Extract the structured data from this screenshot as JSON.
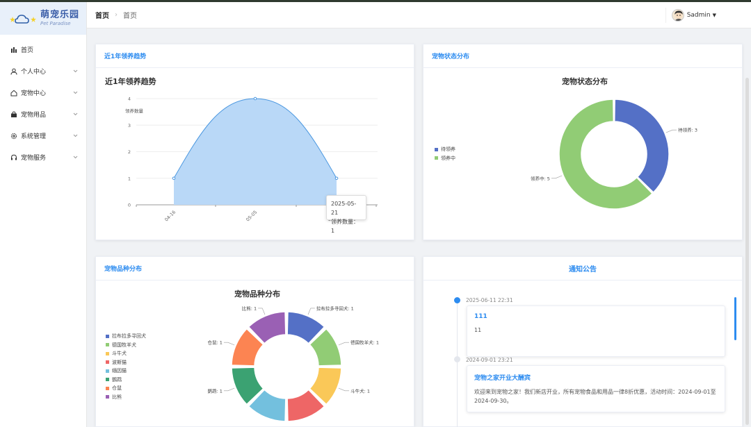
{
  "app": {
    "title": "萌宠乐园",
    "subtitle": "Pet Paradise"
  },
  "sidebar": {
    "items": [
      {
        "label": "首页",
        "icon": "bar-chart-icon",
        "has_children": false
      },
      {
        "label": "个人中心",
        "icon": "user-icon",
        "has_children": true
      },
      {
        "label": "宠物中心",
        "icon": "home-icon",
        "has_children": true
      },
      {
        "label": "宠物用品",
        "icon": "bag-icon",
        "has_children": true
      },
      {
        "label": "系统管理",
        "icon": "gear-icon",
        "has_children": true
      },
      {
        "label": "宠物服务",
        "icon": "headset-icon",
        "has_children": true
      }
    ]
  },
  "header": {
    "breadcrumb_home": "首页",
    "breadcrumb_sep": "›",
    "breadcrumb_current": "首页",
    "user_name": "Sadmin"
  },
  "cards": {
    "trend": {
      "header": "近1年领养趋势"
    },
    "status": {
      "header": "宠物状态分布"
    },
    "breed": {
      "header": "宠物品种分布"
    },
    "notice": {
      "header": "通知公告"
    }
  },
  "chart_data": [
    {
      "type": "area",
      "title": "近1年领养趋势",
      "ylabel": "领养数量",
      "x": [
        "04-16",
        "05-05",
        "05-21"
      ],
      "values": [
        1,
        4,
        1
      ],
      "ylim": [
        0,
        4
      ],
      "yticks": [
        0,
        1,
        2,
        3,
        4
      ],
      "grid": true,
      "tooltip": {
        "date": "2025-05-21",
        "label": "领养数量",
        "value": "1"
      },
      "color": "#b9d8f7",
      "line_color": "#4a97e0"
    },
    {
      "type": "pie",
      "title": "宠物状态分布",
      "donut": true,
      "series": [
        {
          "name": "待领养",
          "value": 3,
          "color": "#5470c6",
          "label": "待领养: 3"
        },
        {
          "name": "领养中",
          "value": 5,
          "color": "#91cc75",
          "label": "领养中: 5"
        }
      ],
      "legend": "left"
    },
    {
      "type": "pie",
      "title": "宠物品种分布",
      "donut": true,
      "series": [
        {
          "name": "拉布拉多寻回犬",
          "value": 1,
          "color": "#5470c6",
          "label": "拉布拉多寻回犬: 1"
        },
        {
          "name": "德国牧羊犬",
          "value": 1,
          "color": "#91cc75",
          "label": "德国牧羊犬: 1"
        },
        {
          "name": "斗牛犬",
          "value": 1,
          "color": "#fac858",
          "label": "斗牛犬: 1"
        },
        {
          "name": "波斯猫",
          "value": 1,
          "color": "#ee6666",
          "label": ""
        },
        {
          "name": "缅因猫",
          "value": 1,
          "color": "#73c0de",
          "label": ""
        },
        {
          "name": "鹦鹉",
          "value": 1,
          "color": "#3ba272",
          "label": "鹦鹉: 1"
        },
        {
          "name": "仓鼠",
          "value": 1,
          "color": "#fc8452",
          "label": "仓鼠: 1"
        },
        {
          "name": "比熊",
          "value": 1,
          "color": "#9a60b4",
          "label": "比熊: 1"
        }
      ],
      "legend": "left"
    }
  ],
  "notices": [
    {
      "date": "2025-06-11 22:31",
      "title": "111",
      "content": "11",
      "dot_color": "#2d8cf0"
    },
    {
      "date": "2024-09-01 23:21",
      "title": "宠物之家开业大酬宾",
      "content": "欢迎来到宠物之家！我们新店开业，所有宠物食品和用品一律8折优惠，活动时间：2024-09-01至2024-09-30。",
      "dot_color": "#e4e7ed"
    }
  ]
}
